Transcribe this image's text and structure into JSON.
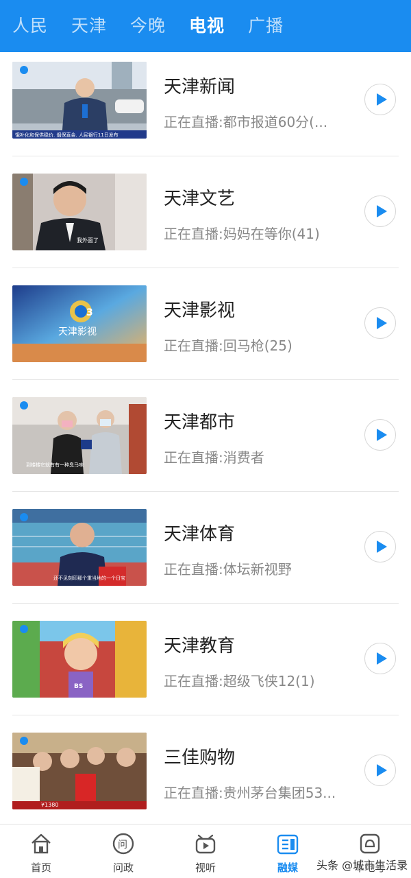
{
  "top_tabs": [
    {
      "label": "人民"
    },
    {
      "label": "天津"
    },
    {
      "label": "今晚"
    },
    {
      "label": "电视",
      "active": true
    },
    {
      "label": "广播"
    }
  ],
  "channels": [
    {
      "name": "天津新闻",
      "now_playing": "正在直播:都市报道60分(...",
      "thumb_overlay": "饿补化和保供稳价.    烟保直金.  人民银行11日发布"
    },
    {
      "name": "天津文艺",
      "now_playing": "正在直播:妈妈在等你(41)",
      "thumb_overlay": "我外面了"
    },
    {
      "name": "天津影视",
      "now_playing": "正在直播:回马枪(25)",
      "thumb_overlay": "天津影视"
    },
    {
      "name": "天津都市",
      "now_playing": "正在直播:消费者",
      "thumb_overlay": "到楼楼它就有有一种臭马味"
    },
    {
      "name": "天津体育",
      "now_playing": "正在直播:体坛新视野",
      "thumb_overlay": "还不见刻印那个重当地的一个日宝"
    },
    {
      "name": "天津教育",
      "now_playing": "正在直播:超级飞侠12(1)",
      "thumb_overlay": "BS"
    },
    {
      "name": "三佳购物",
      "now_playing": "正在直播:贵州茅台集团53...",
      "thumb_overlay": "¥1380"
    }
  ],
  "bottom_nav": [
    {
      "label": "首页",
      "icon": "home-icon"
    },
    {
      "label": "问政",
      "icon": "ask-icon"
    },
    {
      "label": "视听",
      "icon": "tv-icon"
    },
    {
      "label": "融媒",
      "icon": "media-icon",
      "active": true
    },
    {
      "label": "本地号",
      "icon": "local-icon"
    }
  ],
  "watermark": "头条 @城市生活录",
  "colors": {
    "accent": "#1a8cf0",
    "title": "#222222",
    "subtitle": "#888888"
  }
}
